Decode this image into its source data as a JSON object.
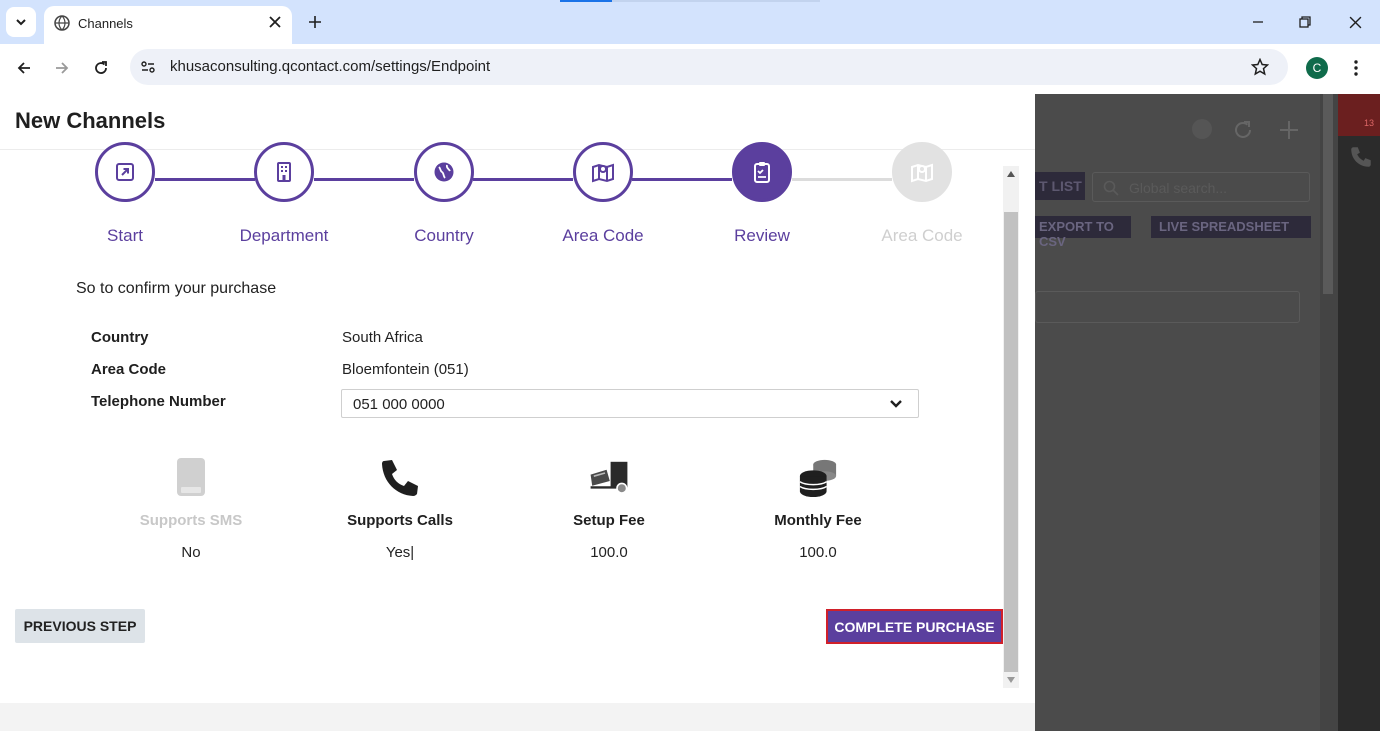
{
  "browser": {
    "tab_title": "Channels",
    "url": "khusaconsulting.qcontact.com/settings/Endpoint",
    "profile_initial": "C"
  },
  "background_app": {
    "list_btn": "T LIST",
    "search_placeholder": "Global search...",
    "export_btn": "EXPORT TO CSV",
    "live_btn": "LIVE SPREADSHEET",
    "badge_count": "13"
  },
  "modal": {
    "title": "New Channels",
    "steps": [
      {
        "label": "Start",
        "icon": "external-link-icon",
        "state": "complete"
      },
      {
        "label": "Department",
        "icon": "building-icon",
        "state": "complete"
      },
      {
        "label": "Country",
        "icon": "globe-icon",
        "state": "complete"
      },
      {
        "label": "Area Code",
        "icon": "map-icon",
        "state": "complete"
      },
      {
        "label": "Review",
        "icon": "clipboard-icon",
        "state": "active"
      },
      {
        "label": "Area Code",
        "icon": "map-icon",
        "state": "disabled"
      }
    ],
    "confirm_text": "So to confirm your purchase",
    "details": {
      "country_label": "Country",
      "country_value": "South Africa",
      "area_code_label": "Area Code",
      "area_code_value": "Bloemfontein (051)",
      "telephone_label": "Telephone Number",
      "telephone_value": "051 000 0000"
    },
    "features": [
      {
        "label": "Supports SMS",
        "value": "No",
        "icon": "phone-device-icon",
        "enabled": false
      },
      {
        "label": "Supports Calls",
        "value": "Yes|",
        "icon": "phone-call-icon",
        "enabled": true
      },
      {
        "label": "Setup Fee",
        "value": "100.0",
        "icon": "truck-loading-icon",
        "enabled": true
      },
      {
        "label": "Monthly Fee",
        "value": "100.0",
        "icon": "coins-icon",
        "enabled": true
      }
    ],
    "prev_button": "PREVIOUS STEP",
    "complete_button": "COMPLETE PURCHASE"
  },
  "colors": {
    "brand_purple": "#5b3f9e",
    "highlight_red": "#d0202a"
  }
}
